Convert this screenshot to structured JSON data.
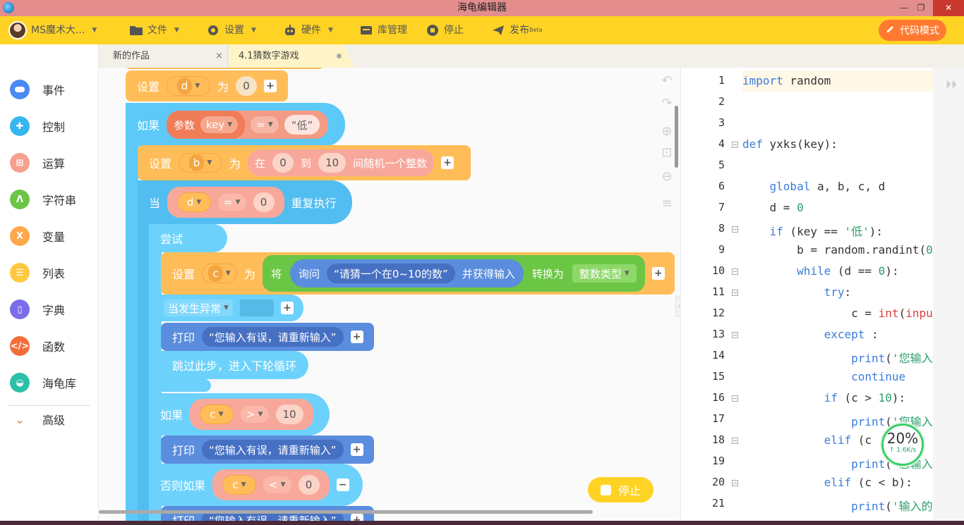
{
  "window": {
    "title": "海龟编辑器"
  },
  "toolbar": {
    "user": "MS魔术大...",
    "file": "文件",
    "settings": "设置",
    "hardware": "硬件",
    "library": "库管理",
    "stop": "停止",
    "publish": "发布",
    "publish_sup": "Beta",
    "code_mode": "代码模式"
  },
  "tabs": [
    {
      "label": "新的作品",
      "close": "×"
    },
    {
      "label": "4.1猜数字游戏"
    }
  ],
  "sidebar": {
    "items": [
      {
        "label": "事件",
        "icon": "event-icon",
        "color": "#4a8af4"
      },
      {
        "label": "控制",
        "icon": "gamepad-icon",
        "color": "#35b6ee"
      },
      {
        "label": "运算",
        "icon": "calculator-icon",
        "color": "#f7a08d"
      },
      {
        "label": "字符串",
        "icon": "string-icon",
        "color": "#6cc645"
      },
      {
        "label": "变量",
        "icon": "variable-icon",
        "color": "#ffa84b"
      },
      {
        "label": "列表",
        "icon": "list-icon",
        "color": "#ffc83d"
      },
      {
        "label": "字典",
        "icon": "dictionary-icon",
        "color": "#7b6de8"
      },
      {
        "label": "函数",
        "icon": "function-icon",
        "color": "#f36d3a"
      },
      {
        "label": "海龟库",
        "icon": "turtle-icon",
        "color": "#2cc0a8"
      }
    ],
    "advanced": "高级"
  },
  "blocks": {
    "set1": {
      "kw": "设置",
      "var": "d",
      "as": "为",
      "val": "0"
    },
    "if1": {
      "kw": "如果",
      "param": "参数",
      "key": "key",
      "op": "=",
      "str": "“低”"
    },
    "set2": {
      "kw": "设置",
      "var": "b",
      "as": "为",
      "from": "在",
      "lo": "0",
      "to": "到",
      "hi": "10",
      "tail": "间随机一个整数"
    },
    "while1": {
      "kw": "当",
      "var": "d",
      "op": "=",
      "val": "0",
      "tail": "重复执行"
    },
    "try": {
      "kw": "尝试"
    },
    "set3": {
      "kw": "设置",
      "var": "c",
      "as": "为",
      "conv": "将",
      "ask": "询问",
      "prompt": "“请猜一个在0~10的数”",
      "ask_tail": "并获得输入",
      "convert": "转换为",
      "type": "整数类型"
    },
    "except": {
      "kw": "当发生异常"
    },
    "print1": {
      "kw": "打印",
      "msg": "“您输入有误，请重新输入”"
    },
    "continue": {
      "kw": "跳过此步，进入下轮循环"
    },
    "if2": {
      "kw": "如果",
      "var": "c",
      "op": ">",
      "val": "10"
    },
    "print2": {
      "kw": "打印",
      "msg": "“您输入有误，请重新输入”"
    },
    "elif": {
      "kw": "否则如果",
      "var": "c",
      "op": "<",
      "val": "0"
    },
    "print3": {
      "kw": "打印",
      "msg": "“您输入有误，请重新输入”"
    }
  },
  "stop_button": "停止",
  "editor": {
    "lines": [
      {
        "n": "1",
        "fold": false
      },
      {
        "n": "2",
        "fold": false
      },
      {
        "n": "3",
        "fold": false
      },
      {
        "n": "4",
        "fold": true
      },
      {
        "n": "5",
        "fold": false
      },
      {
        "n": "6",
        "fold": false
      },
      {
        "n": "7",
        "fold": false
      },
      {
        "n": "8",
        "fold": true
      },
      {
        "n": "9",
        "fold": false
      },
      {
        "n": "10",
        "fold": true
      },
      {
        "n": "11",
        "fold": true
      },
      {
        "n": "12",
        "fold": false
      },
      {
        "n": "13",
        "fold": true
      },
      {
        "n": "14",
        "fold": false
      },
      {
        "n": "15",
        "fold": false
      },
      {
        "n": "16",
        "fold": true
      },
      {
        "n": "17",
        "fold": false
      },
      {
        "n": "18",
        "fold": true
      },
      {
        "n": "19",
        "fold": false
      },
      {
        "n": "20",
        "fold": true
      },
      {
        "n": "21",
        "fold": false
      }
    ]
  },
  "meter": {
    "percent": "20%",
    "speed": "↑ 1.6K/s"
  }
}
